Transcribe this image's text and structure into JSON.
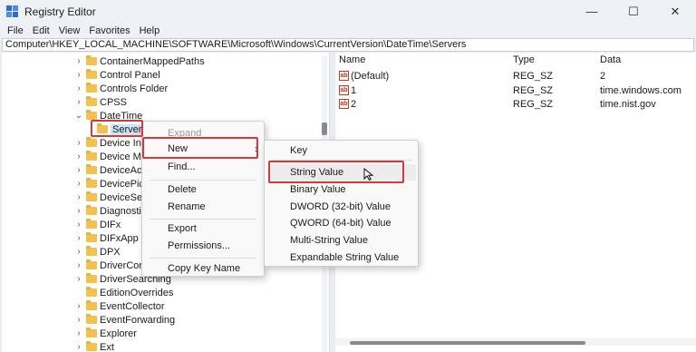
{
  "window": {
    "title": "Registry Editor",
    "minimize": "—",
    "maximize": "☐",
    "close": "✕"
  },
  "menubar": [
    "File",
    "Edit",
    "View",
    "Favorites",
    "Help"
  ],
  "address": "Computer\\HKEY_LOCAL_MACHINE\\SOFTWARE\\Microsoft\\Windows\\CurrentVersion\\DateTime\\Servers",
  "tree": [
    {
      "label": "ContainerMappedPaths",
      "chev": "›"
    },
    {
      "label": "Control Panel",
      "chev": "›"
    },
    {
      "label": "Controls Folder",
      "chev": "›"
    },
    {
      "label": "CPSS",
      "chev": "›"
    },
    {
      "label": "DateTime",
      "chev": "⌄"
    },
    {
      "label": "Servers",
      "chev": ""
    },
    {
      "label": "Device Inst",
      "chev": "›"
    },
    {
      "label": "Device Me",
      "chev": "›"
    },
    {
      "label": "DeviceAcce",
      "chev": "›"
    },
    {
      "label": "DevicePick",
      "chev": "›"
    },
    {
      "label": "DeviceSetu",
      "chev": "›"
    },
    {
      "label": "Diagnostic",
      "chev": "›"
    },
    {
      "label": "DIFx",
      "chev": "›"
    },
    {
      "label": "DIFxApp",
      "chev": "›"
    },
    {
      "label": "DPX",
      "chev": "›"
    },
    {
      "label": "DriverConf",
      "chev": "›"
    },
    {
      "label": "DriverSearching",
      "chev": "›"
    },
    {
      "label": "EditionOverrides",
      "chev": ""
    },
    {
      "label": "EventCollector",
      "chev": "›"
    },
    {
      "label": "EventForwarding",
      "chev": "›"
    },
    {
      "label": "Explorer",
      "chev": "›"
    },
    {
      "label": "Ext",
      "chev": "›"
    }
  ],
  "list": {
    "headers": {
      "name": "Name",
      "type": "Type",
      "data": "Data"
    },
    "rows": [
      {
        "name": "(Default)",
        "type": "REG_SZ",
        "data": "2"
      },
      {
        "name": "1",
        "type": "REG_SZ",
        "data": "time.windows.com"
      },
      {
        "name": "2",
        "type": "REG_SZ",
        "data": "time.nist.gov"
      }
    ],
    "icon_text": "ab"
  },
  "context_menu": {
    "items": [
      "Expand",
      "New",
      "Find...",
      "Delete",
      "Rename",
      "Export",
      "Permissions...",
      "Copy Key Name"
    ],
    "submenu_arrow": "›"
  },
  "submenu": {
    "items": [
      "Key",
      "String Value",
      "Binary Value",
      "DWORD (32-bit) Value",
      "QWORD (64-bit) Value",
      "Multi-String Value",
      "Expandable String Value"
    ]
  },
  "colors": {
    "highlight_border": "#d6393a",
    "folder": "#f2c14e",
    "selection": "#cce4f7"
  }
}
